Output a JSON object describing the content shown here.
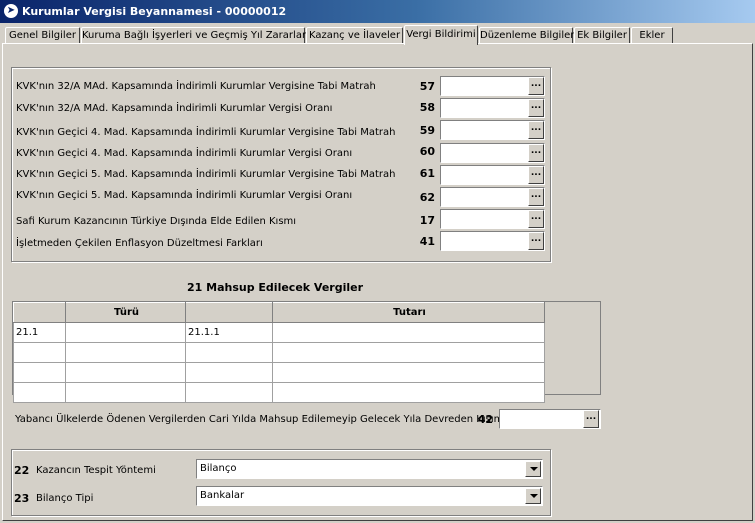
{
  "window": {
    "title": "Kurumlar Vergisi Beyannamesi - 00000012"
  },
  "tabs": [
    {
      "label": "Genel Bilgiler"
    },
    {
      "label": "Kuruma Bağlı İşyerleri ve Geçmiş Yıl Zararları"
    },
    {
      "label": "Kazanç ve İlaveler"
    },
    {
      "label": "Vergi Bildirimi",
      "active": true
    },
    {
      "label": "Düzenleme Bilgileri"
    },
    {
      "label": "Ek Bilgiler"
    },
    {
      "label": "Ekler"
    }
  ],
  "rows": [
    {
      "label": "KVK'nın 32/A MAd. Kapsamında İndirimli Kurumlar Vergisine Tabi Matrah",
      "code": "57",
      "value": ""
    },
    {
      "label": "KVK'nın 32/A MAd. Kapsamında İndirimli Kurumlar Vergisi Oranı",
      "code": "58",
      "value": ""
    },
    {
      "label": "KVK'nın Geçici 4. Mad. Kapsamında İndirimli Kurumlar Vergisine Tabi Matrah",
      "code": "59",
      "value": ""
    },
    {
      "label": "KVK'nın Geçici 4. Mad. Kapsamında İndirimli Kurumlar Vergisi Oranı",
      "code": "60",
      "value": ""
    },
    {
      "label": "KVK'nın Geçici 5. Mad. Kapsamında İndirimli Kurumlar Vergisine Tabi Matrah",
      "code": "61",
      "value": ""
    },
    {
      "label": "KVK'nın Geçici 5. Mad. Kapsamında İndirimli Kurumlar Vergisi Oranı",
      "code": "62",
      "value": ""
    },
    {
      "label": "Safi Kurum Kazancının Türkiye Dışında Elde Edilen Kısmı",
      "code": "17",
      "value": ""
    },
    {
      "label": "İşletmeden Çekilen Enflasyon Düzeltmesi Farkları",
      "code": "41",
      "value": ""
    }
  ],
  "ellipsis": "...",
  "mahsup": {
    "title": "21 Mahsup Edilecek Vergiler",
    "headers": [
      "",
      "Türü",
      "",
      "Tutarı"
    ],
    "rows": [
      [
        "21.1",
        "",
        "21.1.1",
        ""
      ],
      [
        "",
        "",
        "",
        ""
      ],
      [
        "",
        "",
        "",
        ""
      ],
      [
        "",
        "",
        "",
        ""
      ]
    ]
  },
  "devreden": {
    "label": "Yabancı Ülkelerde Ödenen Vergilerden Cari Yılda Mahsup Edilemeyip Gelecek Yıla Devreden Kısım",
    "code": "42",
    "value": ""
  },
  "tespit": {
    "code": "22",
    "label": "Kazancın Tespit Yöntemi",
    "value": "Bilanço"
  },
  "bilanco": {
    "code": "23",
    "label": "Bilanço Tipi",
    "value": "Bankalar"
  }
}
